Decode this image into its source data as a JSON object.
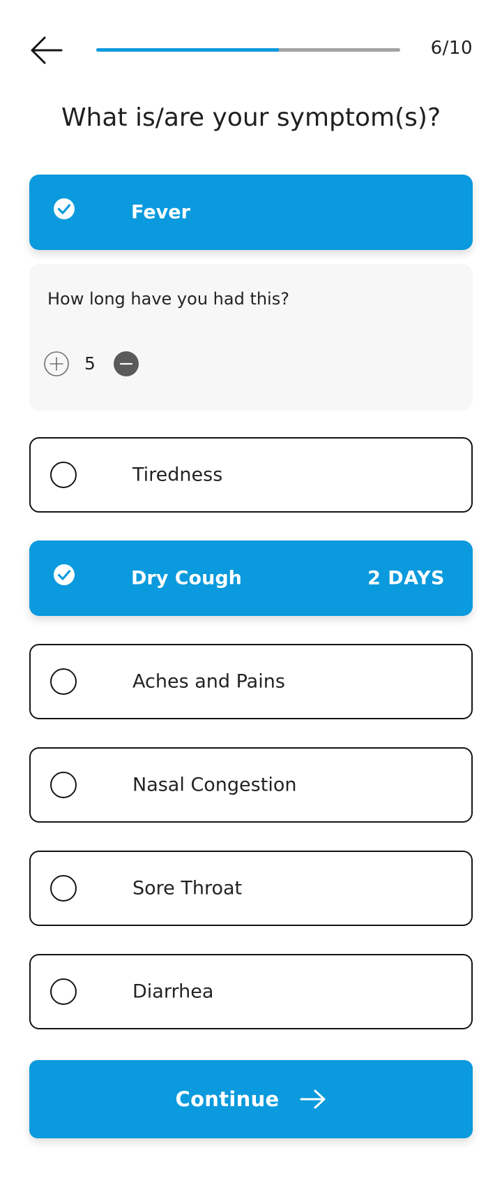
{
  "header": {
    "progress_text": "6/10",
    "progress_fraction": 0.6
  },
  "title": "What is/are your symptom(s)?",
  "symptoms": [
    {
      "label": "Fever",
      "selected": true
    },
    {
      "label": "Tiredness",
      "selected": false
    },
    {
      "label": "Dry Cough",
      "selected": true,
      "days": "2 DAYS"
    },
    {
      "label": "Aches and Pains",
      "selected": false
    },
    {
      "label": "Nasal Congestion",
      "selected": false
    },
    {
      "label": "Sore Throat",
      "selected": false
    },
    {
      "label": "Diarrhea",
      "selected": false
    }
  ],
  "duration": {
    "question": "How long have you had this?",
    "value": "5"
  },
  "continue_label": "Continue",
  "colors": {
    "accent": "#0a9add",
    "progress_track": "#a3a3a3",
    "panel_bg": "#f7f7f7",
    "minus_button": "#5a5a5a"
  },
  "icons": {
    "back": "arrow-left-icon",
    "check": "check-circle-icon",
    "plus": "plus-circle-icon",
    "minus": "minus-circle-icon",
    "continue": "arrow-right-icon"
  }
}
